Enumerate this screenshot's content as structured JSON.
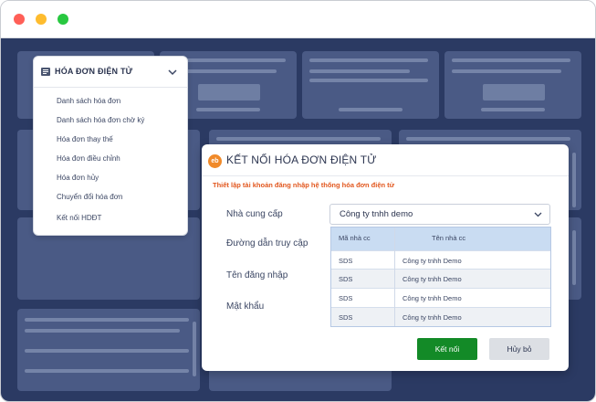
{
  "menu": {
    "title": "HÓA ĐƠN ĐIỆN TỬ",
    "items": [
      {
        "label": "Danh sách hóa đơn"
      },
      {
        "label": "Danh sách hóa đơn chờ ký"
      },
      {
        "label": "Hóa đơn thay thế"
      },
      {
        "label": "Hóa đơn điều chỉnh"
      },
      {
        "label": "Hóa đơn hủy"
      },
      {
        "label": "Chuyển đổi hóa đơn"
      },
      {
        "label": "Kết nối HDĐT"
      }
    ]
  },
  "dialog": {
    "logo_text": "eb",
    "title": "KẾT NỐI HÓA ĐƠN ĐIỆN TỬ",
    "subtitle": "Thiết lập tài khoản đăng nhập hệ thống hóa đơn điện tử",
    "fields": {
      "provider_label": "Nhà cung cấp",
      "url_label": "Đường dẫn truy cập",
      "username_label": "Tên đăng nhập",
      "password_label": "Mật khẩu"
    },
    "provider_value": "Công ty tnhh demo",
    "dropdown": {
      "columns": [
        "Mã nhà cc",
        "Tên nhà cc"
      ],
      "rows": [
        {
          "code": "SDS",
          "name": "Công ty tnhh Demo"
        },
        {
          "code": "SDS",
          "name": "Công ty tnhh Demo"
        },
        {
          "code": "SDS",
          "name": "Công ty tnhh Demo"
        },
        {
          "code": "SDS",
          "name": "Công ty tnhh Demo"
        }
      ]
    },
    "connect_label": "Kết nối",
    "cancel_label": "Hủy bỏ"
  },
  "colors": {
    "background": "#2b3a63",
    "accent_orange": "#e2571e",
    "connect_green": "#138a27"
  },
  "icons": [
    "close-dot-icon",
    "minimize-dot-icon",
    "maximize-dot-icon",
    "invoice-icon",
    "chevron-down-icon",
    "eb-logo-icon"
  ]
}
